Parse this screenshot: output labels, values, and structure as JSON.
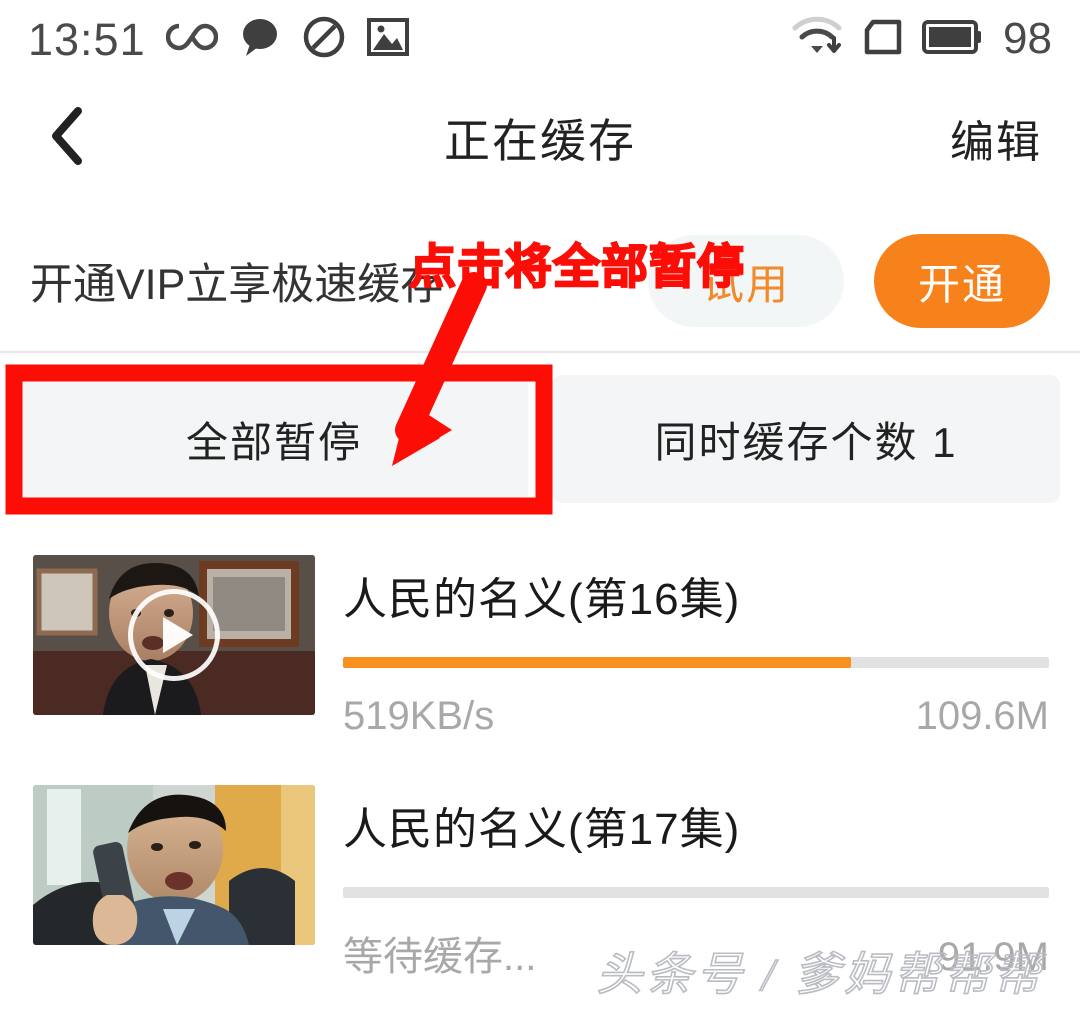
{
  "status_bar": {
    "time": "13:51",
    "battery_percent": "98",
    "icons": [
      "infinity-icon",
      "chat-bubble-icon",
      "do-not-disturb-icon",
      "image-icon",
      "wifi-download-icon",
      "sim-card-icon",
      "battery-icon"
    ]
  },
  "nav_bar": {
    "back_icon": "chevron-left-icon",
    "title": "正在缓存",
    "edit_label": "编辑"
  },
  "vip_banner": {
    "text": "开通VIP立享极速缓存",
    "trial_label": "试用",
    "open_label": "开通",
    "trial_text_color": "#f08a2a",
    "open_bg_color": "#f7821b"
  },
  "tabs": [
    {
      "label": "全部暂停",
      "name": "pause-all"
    },
    {
      "label": "同时缓存个数 1",
      "name": "concurrent-count"
    }
  ],
  "downloads": [
    {
      "title": "人民的名义(第16集)",
      "status": "519KB/s",
      "size": "109.6M",
      "progress_percent": 72,
      "progress_color": "#f7901e",
      "thumb_alt": "man-in-dark-suit-office-scene",
      "has_play_overlay": true
    },
    {
      "title": "人民的名义(第17集)",
      "status": "等待缓存...",
      "size": "91.9M",
      "progress_percent": 0,
      "progress_color": "#f7901e",
      "thumb_alt": "man-on-phone-blue-suit-scene",
      "has_play_overlay": false
    }
  ],
  "annotation": {
    "text": "点击将全部暂停",
    "color": "#fc0d05",
    "highlight_target": "全部暂停"
  },
  "watermark": {
    "text": "头条号 / 爹妈帮帮帮"
  }
}
